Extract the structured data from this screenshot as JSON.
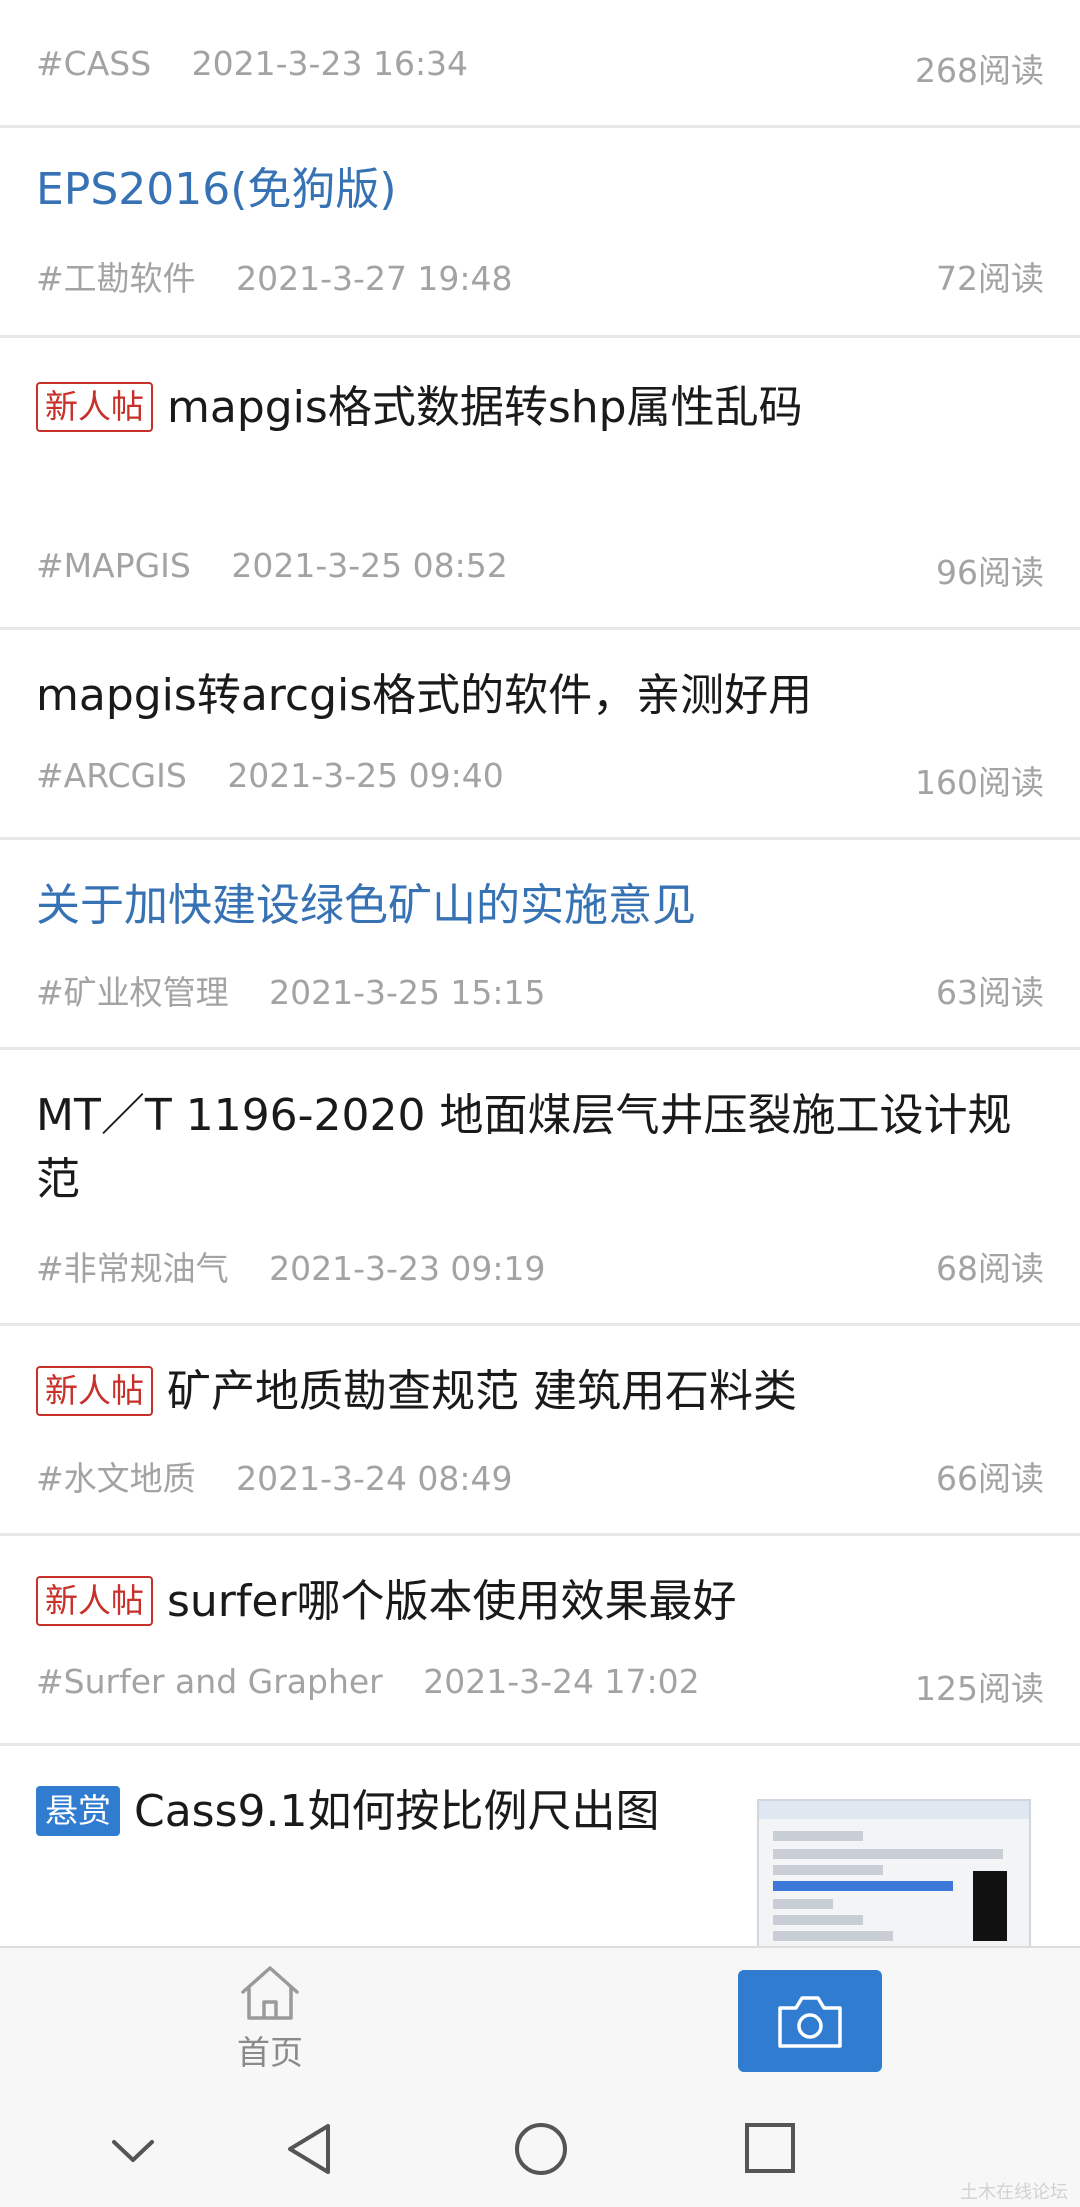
{
  "posts": [
    {
      "title": "",
      "tag": "#CASS",
      "time": "2021-3-23 16:34",
      "reads": "268阅读"
    },
    {
      "title": "EPS2016(免狗版)",
      "tag": "#工勘软件",
      "time": "2021-3-27 19:48",
      "reads": "72阅读"
    },
    {
      "badge": "新人帖",
      "title": "mapgis格式数据转shp属性乱码",
      "tag": "#MAPGIS",
      "time": "2021-3-25 08:52",
      "reads": "96阅读"
    },
    {
      "title": "mapgis转arcgis格式的软件，亲测好用",
      "tag": "#ARCGIS",
      "time": "2021-3-25 09:40",
      "reads": "160阅读"
    },
    {
      "title": "关于加快建设绿色矿山的实施意见",
      "tag": "#矿业权管理",
      "time": "2021-3-25 15:15",
      "reads": "63阅读"
    },
    {
      "title": "MT／T 1196-2020 地面煤层气井压裂施工设计规范",
      "tag": "#非常规油气",
      "time": "2021-3-23 09:19",
      "reads": "68阅读"
    },
    {
      "badge": "新人帖",
      "title": "矿产地质勘查规范 建筑用石料类",
      "tag": "#水文地质",
      "time": "2021-3-24 08:49",
      "reads": "66阅读"
    },
    {
      "badge": "新人帖",
      "title": "surfer哪个版本使用效果最好",
      "tag": "#Surfer and Grapher",
      "time": "2021-3-24 17:02",
      "reads": "125阅读"
    },
    {
      "badge": "悬赏",
      "title": "Cass9.1如何按比例尺出图"
    }
  ],
  "bottom_nav": {
    "home_label": "首页"
  },
  "watermark": "土木在线论坛",
  "colors": {
    "link_title": "#3672b4",
    "badge_new": "#c8302a",
    "badge_reward": "#2f7cd0",
    "camera_button": "#2f7cd0"
  }
}
